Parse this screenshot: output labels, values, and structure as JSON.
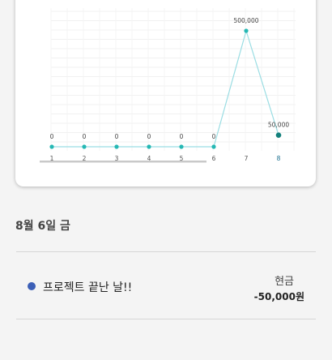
{
  "colors": {
    "line": "#9adde3",
    "point": "#25b8b4",
    "point_selected": "#13807c",
    "selected_tick": "#1a6f8f",
    "entry_dot": "#3c5fb7"
  },
  "chart_data": {
    "type": "line",
    "x": [
      "1",
      "2",
      "3",
      "4",
      "5",
      "6",
      "7",
      "8"
    ],
    "values": [
      0,
      0,
      0,
      0,
      0,
      0,
      500000,
      50000
    ],
    "data_labels": [
      "0",
      "0",
      "0",
      "0",
      "0",
      "0",
      "500,000",
      "50,000"
    ],
    "selected_index": 7,
    "grid": true,
    "legend": "none"
  },
  "day_header": "8월 6일 금",
  "entry": {
    "dot_icon": "category-dot-icon",
    "title": "프로젝트 끝난 날!!",
    "method": "현금",
    "amount": "-50,000원"
  }
}
